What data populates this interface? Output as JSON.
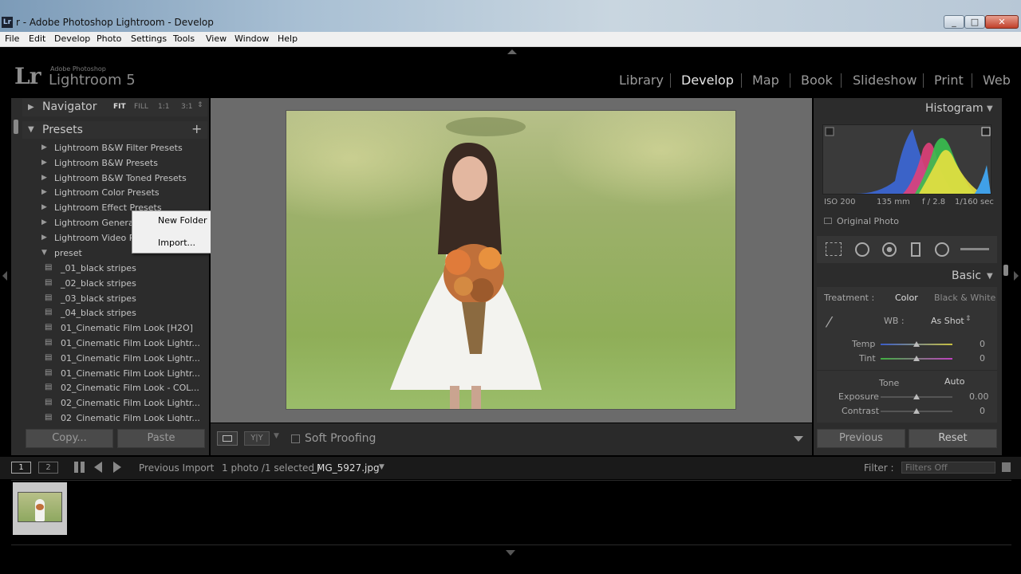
{
  "window": {
    "title": "r - Adobe Photoshop Lightroom - Develop",
    "app_icon": "Lr",
    "controls": [
      "_",
      "□",
      "✕"
    ]
  },
  "menu": [
    "File",
    "Edit",
    "Develop",
    "Photo",
    "Settings",
    "Tools",
    "View",
    "Window",
    "Help"
  ],
  "brand": {
    "lr": "Lr",
    "small": "Adobe Photoshop",
    "big": "Lightroom 5"
  },
  "modules": [
    "Library",
    "Develop",
    "Map",
    "Book",
    "Slideshow",
    "Print",
    "Web"
  ],
  "active_module": "Develop",
  "left": {
    "navigator": {
      "title": "Navigator",
      "zoom": [
        "FIT",
        "FILL",
        "1:1",
        "3:1"
      ]
    },
    "presets": {
      "title": "Presets",
      "add": "+",
      "folders": [
        "Lightroom B&W Filter Presets",
        "Lightroom B&W Presets",
        "Lightroom B&W Toned Presets",
        "Lightroom Color Presets",
        "Lightroom Effect Presets",
        "Lightroom General",
        "Lightroom Video Pr",
        "preset"
      ],
      "items": [
        "_01_black stripes",
        "_02_black stripes",
        "_03_black stripes",
        "_04_black stripes",
        "01_Cinematic Film Look [H2O]",
        "01_Cinematic Film Look Lightr...",
        "01_Cinematic Film Look Lightr...",
        "01_Cinematic Film Look Lightr...",
        "02_Cinematic Film Look - COL...",
        "02_Cinematic Film Look Lightr...",
        "02_Cinematic Film Look Lightr..."
      ]
    },
    "copy": "Copy...",
    "paste": "Paste"
  },
  "context_menu": [
    "New Folder",
    "Import..."
  ],
  "toolbar": {
    "soft_proofing": "Soft Proofing",
    "compare": "Y|Y"
  },
  "right": {
    "histogram": {
      "title": "Histogram",
      "iso": "ISO 200",
      "focal": "135 mm",
      "aperture": "f / 2.8",
      "shutter": "1/160 sec",
      "original": "Original Photo"
    },
    "basic": {
      "title": "Basic",
      "treatment_label": "Treatment :",
      "treatment_color": "Color",
      "treatment_bw": "Black & White",
      "wb_label": "WB :",
      "wb_value": "As Shot",
      "temp_label": "Temp",
      "temp_value": "0",
      "tint_label": "Tint",
      "tint_value": "0",
      "tone_label": "Tone",
      "auto": "Auto",
      "exposure_label": "Exposure",
      "exposure_value": "0.00",
      "contrast_label": "Contrast",
      "contrast_value": "0"
    },
    "previous": "Previous",
    "reset": "Reset"
  },
  "filmbar": {
    "view1": "1",
    "view2": "2",
    "source": "Previous Import",
    "count": "1 photo /1 selected /",
    "filename": "_MG_5927.jpg",
    "filter_label": "Filter :",
    "filter_value": "Filters Off"
  },
  "colors": {
    "bg": "#000000",
    "panel": "#2c2c2c",
    "center": "#6b6b6b",
    "accent_active": "#e6e6e6"
  }
}
